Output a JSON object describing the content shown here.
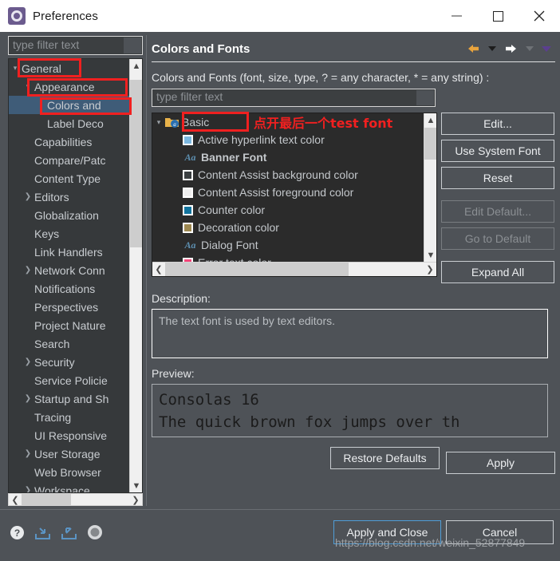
{
  "window": {
    "title": "Preferences",
    "icon": "preferences-gear-icon",
    "controls": {
      "minimize": "minimize-icon",
      "maximize": "maximize-icon",
      "close": "close-icon"
    }
  },
  "sidebar": {
    "filter_placeholder": "type filter text",
    "items": [
      {
        "label": "General",
        "indent": 0,
        "arrow": "down",
        "selected": false
      },
      {
        "label": "Appearance",
        "indent": 1,
        "arrow": "down",
        "selected": false
      },
      {
        "label": "Colors and",
        "indent": 2,
        "arrow": "none",
        "selected": true
      },
      {
        "label": "Label Deco",
        "indent": 2,
        "arrow": "none",
        "selected": false
      },
      {
        "label": "Capabilities",
        "indent": 1,
        "arrow": "none",
        "selected": false
      },
      {
        "label": "Compare/Patc",
        "indent": 1,
        "arrow": "none",
        "selected": false
      },
      {
        "label": "Content Type",
        "indent": 1,
        "arrow": "none",
        "selected": false
      },
      {
        "label": "Editors",
        "indent": 1,
        "arrow": "right",
        "selected": false
      },
      {
        "label": "Globalization",
        "indent": 1,
        "arrow": "none",
        "selected": false
      },
      {
        "label": "Keys",
        "indent": 1,
        "arrow": "none",
        "selected": false
      },
      {
        "label": "Link Handlers",
        "indent": 1,
        "arrow": "none",
        "selected": false
      },
      {
        "label": "Network Conn",
        "indent": 1,
        "arrow": "right",
        "selected": false
      },
      {
        "label": "Notifications",
        "indent": 1,
        "arrow": "none",
        "selected": false
      },
      {
        "label": "Perspectives",
        "indent": 1,
        "arrow": "none",
        "selected": false
      },
      {
        "label": "Project Nature",
        "indent": 1,
        "arrow": "none",
        "selected": false
      },
      {
        "label": "Search",
        "indent": 1,
        "arrow": "none",
        "selected": false
      },
      {
        "label": "Security",
        "indent": 1,
        "arrow": "right",
        "selected": false
      },
      {
        "label": "Service Policie",
        "indent": 1,
        "arrow": "none",
        "selected": false
      },
      {
        "label": "Startup and Sh",
        "indent": 1,
        "arrow": "right",
        "selected": false
      },
      {
        "label": "Tracing",
        "indent": 1,
        "arrow": "none",
        "selected": false
      },
      {
        "label": "UI Responsive",
        "indent": 1,
        "arrow": "none",
        "selected": false
      },
      {
        "label": "User Storage",
        "indent": 1,
        "arrow": "right",
        "selected": false
      },
      {
        "label": "Web Browser",
        "indent": 1,
        "arrow": "none",
        "selected": false
      },
      {
        "label": "Workspace",
        "indent": 1,
        "arrow": "right",
        "selected": false
      }
    ]
  },
  "pane": {
    "title": "Colors and Fonts",
    "nav": {
      "back": "back-arrow-icon",
      "back_menu": "back-dropdown-icon",
      "forward": "forward-arrow-icon",
      "forward_menu": "forward-dropdown-icon",
      "view_menu": "view-menu-icon"
    },
    "filter_label": "Colors and Fonts (font, size, type, ? = any character, * = any string) :",
    "filter_label_mnemonic": "F",
    "filter_placeholder": "type filter text"
  },
  "colors_tree": {
    "nodes": [
      {
        "label": "Basic",
        "kind": "folder",
        "arrow": "down",
        "depth": 0,
        "bold": false,
        "color": ""
      },
      {
        "label": "Active hyperlink text color",
        "kind": "swatch",
        "arrow": "none",
        "depth": 1,
        "bold": false,
        "color": "#7cb8e0"
      },
      {
        "label": "Banner Font",
        "kind": "font",
        "arrow": "none",
        "depth": 1,
        "bold": true,
        "color": ""
      },
      {
        "label": "Content Assist background color",
        "kind": "swatch",
        "arrow": "none",
        "depth": 1,
        "bold": false,
        "color": "#3b3f41"
      },
      {
        "label": "Content Assist foreground color",
        "kind": "swatch",
        "arrow": "none",
        "depth": 1,
        "bold": false,
        "color": "#eeeeee"
      },
      {
        "label": "Counter color",
        "kind": "swatch",
        "arrow": "none",
        "depth": 1,
        "bold": false,
        "color": "#12749e"
      },
      {
        "label": "Decoration color",
        "kind": "swatch",
        "arrow": "none",
        "depth": 1,
        "bold": false,
        "color": "#9d8850"
      },
      {
        "label": "Dialog Font",
        "kind": "font",
        "arrow": "none",
        "depth": 1,
        "bold": false,
        "color": ""
      },
      {
        "label": "Error text color",
        "kind": "swatch",
        "arrow": "none",
        "depth": 1,
        "bold": false,
        "color": "#f5457a"
      }
    ]
  },
  "buttons": {
    "edit": "Edit...",
    "use_system_font": "Use System Font",
    "reset": "Reset",
    "edit_default": "Edit Default...",
    "go_to_default": "Go to Default",
    "expand_all": "Expand All"
  },
  "description": {
    "label": "Description:",
    "text": "The text font is used by text editors."
  },
  "preview": {
    "label": "Preview:",
    "line1": "Consolas 16",
    "line2": "The quick brown fox jumps over th"
  },
  "apply_row": {
    "restore_defaults": "Restore Defaults",
    "apply": "Apply"
  },
  "footer": {
    "icons": [
      "help-icon",
      "import-icon",
      "export-icon",
      "settings-circle-icon"
    ],
    "apply_and_close": "Apply and Close",
    "cancel": "Cancel",
    "watermark": "https://blog.csdn.net/weixin_52877849"
  },
  "annotations": {
    "note_text": "点开最后一个test font",
    "color": "#f02020"
  }
}
